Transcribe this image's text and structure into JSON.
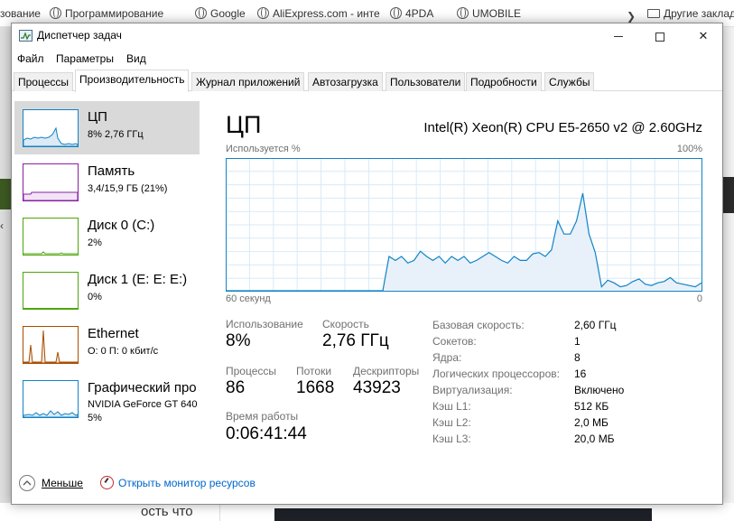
{
  "browser": {
    "bookmarks": [
      "зование",
      "Программирование",
      "Google",
      "AliExpress.com - инте",
      "4PDA",
      "UMOBILE"
    ],
    "other_bookmarks": "Другие закладки",
    "bottom_text": "ость  что"
  },
  "window": {
    "title": "Диспетчер задач",
    "min": "—",
    "close": "✕"
  },
  "menu": [
    "Файл",
    "Параметры",
    "Вид"
  ],
  "tabs": [
    "Процессы",
    "Производительность",
    "Журнал приложений",
    "Автозагрузка",
    "Пользователи",
    "Подробности",
    "Службы"
  ],
  "active_tab": 1,
  "sidebar": [
    {
      "title": "ЦП",
      "sub": "8% 2,76 ГГц",
      "color": "#1183c6"
    },
    {
      "title": "Память",
      "sub": "3,4/15,9 ГБ (21%)",
      "color": "#8b1fa3"
    },
    {
      "title": "Диск 0 (C:)",
      "sub": "2%",
      "color": "#4da60c"
    },
    {
      "title": "Диск 1 (E: E: E:)",
      "sub": "0%",
      "color": "#4da60c"
    },
    {
      "title": "Ethernet",
      "sub": "О: 0 П: 0 кбит/с",
      "color": "#a74f01"
    },
    {
      "title": "Графический про",
      "sub": "NVIDIA GeForce GT 640",
      "sub2": "5%",
      "color": "#1183c6"
    }
  ],
  "cpu": {
    "title": "ЦП",
    "name": "Intel(R) Xeon(R) CPU E5-2650 v2 @ 2.60GHz",
    "graph_label_left": "Используется %",
    "graph_label_right": "100%",
    "graph_foot_left": "60 секунд",
    "graph_foot_right": "0",
    "usage_percent_history": [
      0,
      0,
      0,
      0,
      0,
      0,
      0,
      0,
      0,
      0,
      0,
      0,
      0,
      0,
      0,
      0,
      0,
      0,
      0,
      0,
      0,
      0,
      0,
      0,
      0,
      0,
      26,
      23,
      26,
      21,
      23,
      30,
      26,
      23,
      26,
      21,
      26,
      23,
      26,
      21,
      23,
      26,
      29,
      26,
      23,
      21,
      26,
      23,
      23,
      28,
      29,
      26,
      31,
      53,
      43,
      43,
      53,
      74,
      43,
      29,
      3,
      8,
      6,
      3,
      4,
      7,
      9,
      5,
      4,
      6,
      7,
      10,
      6,
      5,
      4,
      3,
      6
    ]
  },
  "stats": {
    "usage_label": "Использование",
    "usage_value": "8%",
    "speed_label": "Скорость",
    "speed_value": "2,76 ГГц",
    "processes_label": "Процессы",
    "processes_value": "86",
    "threads_label": "Потоки",
    "threads_value": "1668",
    "handles_label": "Дескрипторы",
    "handles_value": "43923",
    "uptime_label": "Время работы",
    "uptime_value": "0:06:41:44"
  },
  "specs": [
    {
      "label": "Базовая скорость:",
      "value": "2,60 ГГц"
    },
    {
      "label": "Сокетов:",
      "value": "1"
    },
    {
      "label": "Ядра:",
      "value": "8"
    },
    {
      "label": "Логических процессоров:",
      "value": "16"
    },
    {
      "label": "Виртуализация:",
      "value": "Включено"
    },
    {
      "label": "Кэш L1:",
      "value": "512 КБ"
    },
    {
      "label": "Кэш L2:",
      "value": "2,0 МБ"
    },
    {
      "label": "Кэш L3:",
      "value": "20,0 МБ"
    }
  ],
  "footer": {
    "fewer": "Меньше",
    "resmon": "Открыть монитор ресурсов"
  }
}
